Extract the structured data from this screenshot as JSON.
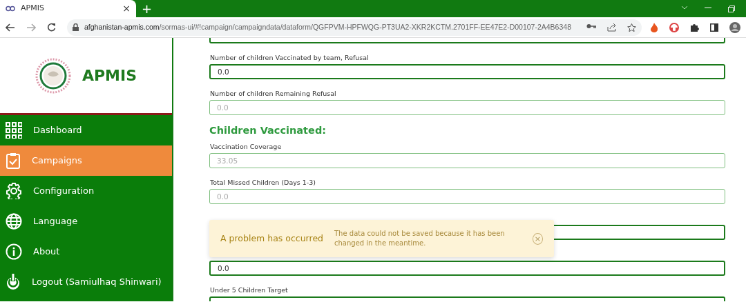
{
  "browser": {
    "tab_title": "APMIS",
    "tab_close": "×",
    "new_tab": "+",
    "url_host": "afghanistan-apmis.com",
    "url_path": "/sormas-ui/#!campaign/campaigndata/dataform/QGFPVM-HPFWQG-PT3UA2-XKR2KCTM.2701FF-EE47E2-D00107-2A4B6348"
  },
  "sidebar": {
    "logo_text": "APMIS",
    "items": [
      {
        "label": "Dashboard",
        "selected": false
      },
      {
        "label": "Campaigns",
        "selected": true
      },
      {
        "label": "Configuration",
        "selected": false
      },
      {
        "label": "Language",
        "selected": false
      },
      {
        "label": "About",
        "selected": false
      },
      {
        "label": "Logout (Samiulhaq Shinwari)",
        "selected": false
      }
    ]
  },
  "form": [
    {
      "kind": "field",
      "disabled": false
    },
    {
      "kind": "field",
      "label": "Number of children Vaccinated by team, Refusal",
      "value": "0.0",
      "disabled": false
    },
    {
      "kind": "field",
      "label": "Number of children Remaining Refusal",
      "value": "0.0",
      "disabled": true
    },
    {
      "kind": "heading",
      "label": "Children Vaccinated:"
    },
    {
      "kind": "field",
      "label": "Vaccination Coverage",
      "value": "33.05",
      "disabled": true
    },
    {
      "kind": "field",
      "label": "Total Missed Children (Days 1-3)",
      "value": "0.0",
      "disabled": true
    },
    {
      "kind": "field",
      "disabled": false
    },
    {
      "kind": "field",
      "value": "0.0",
      "disabled": false
    },
    {
      "kind": "field",
      "label": "Under 5 Children Target",
      "disabled": false
    }
  ],
  "notification": {
    "title": "A problem has occurred",
    "message": "The data could not be saved because it has been changed in the meantime.",
    "close": "×"
  }
}
